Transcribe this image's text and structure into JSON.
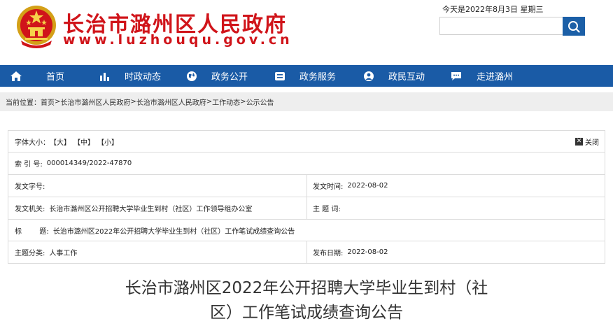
{
  "header": {
    "site_name": "长治市潞州区人民政府",
    "site_url": "www.luzhouqu.gov.cn",
    "date": "今天是2022年8月3日 星期三",
    "search_placeholder": "",
    "brand_color": "#d0141a",
    "nav_color": "#1a5ba6"
  },
  "nav": {
    "items": [
      {
        "label": "首页",
        "icon": "home-icon"
      },
      {
        "label": "时政动态",
        "icon": "bar-chart-icon"
      },
      {
        "label": "政务公开",
        "icon": "globe-icon"
      },
      {
        "label": "政务服务",
        "icon": "service-icon"
      },
      {
        "label": "政民互动",
        "icon": "interaction-icon"
      },
      {
        "label": "走进潞州",
        "icon": "chat-icon"
      }
    ]
  },
  "breadcrumb": {
    "label": "当前位置：",
    "items": [
      "首页",
      "长治市潞州区人民政府",
      "长治市潞州区人民政府",
      "工作动态",
      "公示公告"
    ]
  },
  "info": {
    "font_size_label": "字体大小：",
    "sizes": [
      "【大】",
      "【中】",
      "【小】"
    ],
    "close_label": "关闭",
    "index_label": "索  引  号:",
    "index_value": "000014349/2022-47870",
    "doc_no_label": "发文字号:",
    "doc_no_value": "",
    "issue_time_label": "发文时间:",
    "issue_time_value": "2022-08-02",
    "issuer_label": "发文机关:",
    "issuer_value": "长治市潞州区公开招聘大学毕业生到村（社区）工作领导组办公室",
    "keyword_label": "主  题  词:",
    "keyword_value": "",
    "title_label": "标        题:",
    "title_value": "长治市潞州区2022年公开招聘大学毕业生到村（社区）工作笔试成绩查询公告",
    "category_label": "主题分类:",
    "category_value": "人事工作",
    "publish_date_label": "发布日期:",
    "publish_date_value": "2022-08-02"
  },
  "article": {
    "title_line1": "长治市潞州区2022年公开招聘大学毕业生到村（社",
    "title_line2": "区）工作笔试成绩查询公告"
  }
}
